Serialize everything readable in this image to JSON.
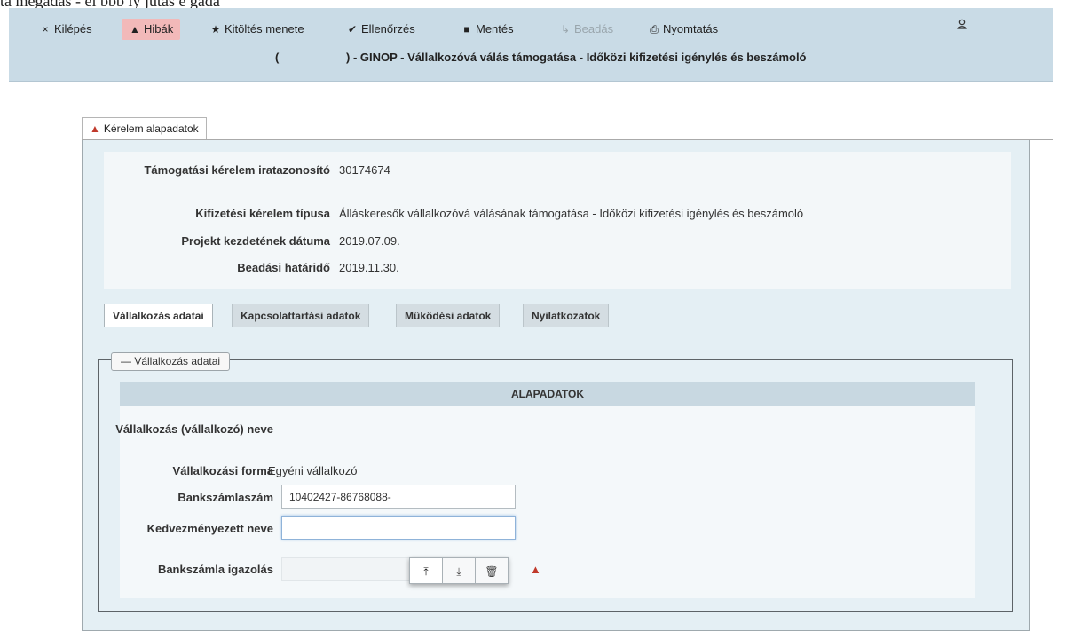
{
  "top_fragment": "ta megadás - el     bbb ly jutas    e gada",
  "toolbar": {
    "items": [
      {
        "icon": "×",
        "label": "Kilépés"
      },
      {
        "icon": "▲",
        "label": "Hibák"
      },
      {
        "icon": "★",
        "label": "Kitöltés menete"
      },
      {
        "icon": "✔",
        "label": "Ellenőrzés"
      },
      {
        "icon": "■",
        "label": "Mentés"
      },
      {
        "icon": "↳",
        "label": "Beadás"
      },
      {
        "icon": "⎙",
        "label": "Nyomtatás"
      }
    ],
    "user_icon": "user-icon",
    "title_left": "(",
    "title_right": ") - GINOP - Vállalkozóvá válás támogatása - Időközi kifizetési igénylés és beszámoló"
  },
  "main_tab": {
    "label": "Kérelem alapadatok",
    "icon": "warning-icon"
  },
  "info": {
    "rows": [
      {
        "label": "Támogatási kérelem iratazonosító",
        "value": "30174674"
      },
      {
        "label": "Kifizetési kérelem típusa",
        "value": "Álláskeresők vállalkozóvá válásának támogatása - Időközi kifizetési igénylés és beszámoló"
      },
      {
        "label": "Projekt kezdetének dátuma",
        "value": "2019.07.09."
      },
      {
        "label": "Beadási határidő",
        "value": "2019.11.30."
      }
    ]
  },
  "sub_tabs": [
    "Vállalkozás adatai",
    "Kapcsolattartási adatok",
    "Működési adatok",
    "Nyilatkozatok"
  ],
  "fieldset": {
    "legend": "— Vállalkozás adatai",
    "section_title": "ALAPADATOK",
    "fields": {
      "name_label": "Vállalkozás (vállalkozó) neve",
      "name_value": "",
      "form_label": "Vállalkozási forma",
      "form_value": "Egyéni vállalkozó",
      "bank_label": "Bankszámlaszám",
      "bank_value": "10402427-86768088-",
      "beneficiary_label": "Kedvezményezett neve",
      "beneficiary_value": "",
      "proof_label": "Bankszámla igazolás",
      "proof_value": ""
    },
    "buttons": [
      {
        "icon": "⤒",
        "name": "upload-icon"
      },
      {
        "icon": "⤓",
        "name": "download-icon"
      },
      {
        "icon": "🗑",
        "name": "trash-icon"
      }
    ]
  },
  "colors": {
    "toolbar_bg": "#c9dbe6",
    "active_tab_bg": "#f2b9b9",
    "warning": "#c0392b"
  }
}
